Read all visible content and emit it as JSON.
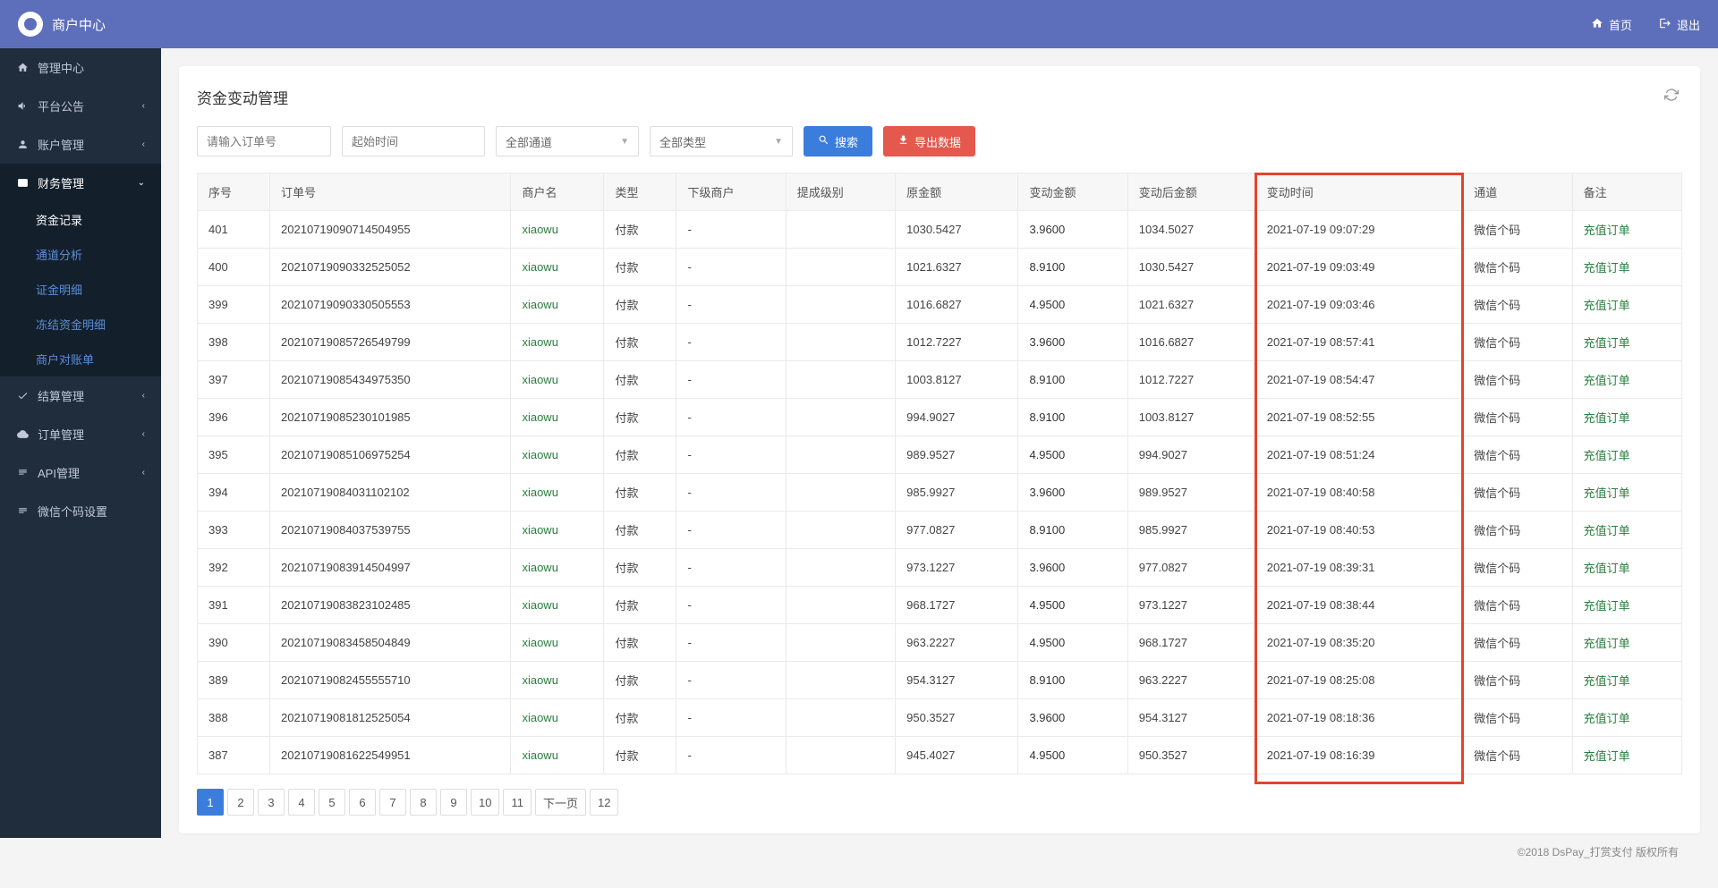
{
  "header": {
    "title": "商户中心",
    "home": "首页",
    "logout": "退出"
  },
  "sidebar": {
    "items": [
      {
        "icon": "home",
        "label": "管理中心",
        "sub": false
      },
      {
        "icon": "speaker",
        "label": "平台公告",
        "sub": true
      },
      {
        "icon": "user",
        "label": "账户管理",
        "sub": true
      },
      {
        "icon": "money",
        "label": "财务管理",
        "sub": true,
        "open": true,
        "children": [
          {
            "label": "资金记录",
            "active": true
          },
          {
            "label": "通道分析"
          },
          {
            "label": "证金明细"
          },
          {
            "label": "冻结资金明细"
          },
          {
            "label": "商户对账单"
          }
        ]
      },
      {
        "icon": "check",
        "label": "结算管理",
        "sub": true
      },
      {
        "icon": "cloud",
        "label": "订单管理",
        "sub": true
      },
      {
        "icon": "api",
        "label": "API管理",
        "sub": true
      },
      {
        "icon": "wechat",
        "label": "微信个码设置",
        "sub": false
      }
    ]
  },
  "page": {
    "title": "资金变动管理",
    "filter": {
      "order_placeholder": "请输入订单号",
      "time_placeholder": "起始时间",
      "channel_default": "全部通道",
      "type_default": "全部类型",
      "search_btn": "搜索",
      "export_btn": "导出数据"
    },
    "table": {
      "headers": [
        "序号",
        "订单号",
        "商户名",
        "类型",
        "下级商户",
        "提成级别",
        "原金额",
        "变动金额",
        "变动后金额",
        "变动时间",
        "通道",
        "备注"
      ],
      "rows": [
        {
          "seq": "401",
          "order": "20210719090714504955",
          "merchant": "xiaowu",
          "type": "付款",
          "sub": "-",
          "lvl": "",
          "orig": "1030.5427",
          "chg": "3.9600",
          "after": "1034.5027",
          "time": "2021-07-19 09:07:29",
          "channel": "微信个码",
          "remark": "充值订单"
        },
        {
          "seq": "400",
          "order": "20210719090332525052",
          "merchant": "xiaowu",
          "type": "付款",
          "sub": "-",
          "lvl": "",
          "orig": "1021.6327",
          "chg": "8.9100",
          "after": "1030.5427",
          "time": "2021-07-19 09:03:49",
          "channel": "微信个码",
          "remark": "充值订单"
        },
        {
          "seq": "399",
          "order": "20210719090330505553",
          "merchant": "xiaowu",
          "type": "付款",
          "sub": "-",
          "lvl": "",
          "orig": "1016.6827",
          "chg": "4.9500",
          "after": "1021.6327",
          "time": "2021-07-19 09:03:46",
          "channel": "微信个码",
          "remark": "充值订单"
        },
        {
          "seq": "398",
          "order": "20210719085726549799",
          "merchant": "xiaowu",
          "type": "付款",
          "sub": "-",
          "lvl": "",
          "orig": "1012.7227",
          "chg": "3.9600",
          "after": "1016.6827",
          "time": "2021-07-19 08:57:41",
          "channel": "微信个码",
          "remark": "充值订单"
        },
        {
          "seq": "397",
          "order": "20210719085434975350",
          "merchant": "xiaowu",
          "type": "付款",
          "sub": "-",
          "lvl": "",
          "orig": "1003.8127",
          "chg": "8.9100",
          "after": "1012.7227",
          "time": "2021-07-19 08:54:47",
          "channel": "微信个码",
          "remark": "充值订单"
        },
        {
          "seq": "396",
          "order": "20210719085230101985",
          "merchant": "xiaowu",
          "type": "付款",
          "sub": "-",
          "lvl": "",
          "orig": "994.9027",
          "chg": "8.9100",
          "after": "1003.8127",
          "time": "2021-07-19 08:52:55",
          "channel": "微信个码",
          "remark": "充值订单"
        },
        {
          "seq": "395",
          "order": "20210719085106975254",
          "merchant": "xiaowu",
          "type": "付款",
          "sub": "-",
          "lvl": "",
          "orig": "989.9527",
          "chg": "4.9500",
          "after": "994.9027",
          "time": "2021-07-19 08:51:24",
          "channel": "微信个码",
          "remark": "充值订单"
        },
        {
          "seq": "394",
          "order": "20210719084031102102",
          "merchant": "xiaowu",
          "type": "付款",
          "sub": "-",
          "lvl": "",
          "orig": "985.9927",
          "chg": "3.9600",
          "after": "989.9527",
          "time": "2021-07-19 08:40:58",
          "channel": "微信个码",
          "remark": "充值订单"
        },
        {
          "seq": "393",
          "order": "20210719084037539755",
          "merchant": "xiaowu",
          "type": "付款",
          "sub": "-",
          "lvl": "",
          "orig": "977.0827",
          "chg": "8.9100",
          "after": "985.9927",
          "time": "2021-07-19 08:40:53",
          "channel": "微信个码",
          "remark": "充值订单"
        },
        {
          "seq": "392",
          "order": "20210719083914504997",
          "merchant": "xiaowu",
          "type": "付款",
          "sub": "-",
          "lvl": "",
          "orig": "973.1227",
          "chg": "3.9600",
          "after": "977.0827",
          "time": "2021-07-19 08:39:31",
          "channel": "微信个码",
          "remark": "充值订单"
        },
        {
          "seq": "391",
          "order": "20210719083823102485",
          "merchant": "xiaowu",
          "type": "付款",
          "sub": "-",
          "lvl": "",
          "orig": "968.1727",
          "chg": "4.9500",
          "after": "973.1227",
          "time": "2021-07-19 08:38:44",
          "channel": "微信个码",
          "remark": "充值订单"
        },
        {
          "seq": "390",
          "order": "20210719083458504849",
          "merchant": "xiaowu",
          "type": "付款",
          "sub": "-",
          "lvl": "",
          "orig": "963.2227",
          "chg": "4.9500",
          "after": "968.1727",
          "time": "2021-07-19 08:35:20",
          "channel": "微信个码",
          "remark": "充值订单"
        },
        {
          "seq": "389",
          "order": "20210719082455555710",
          "merchant": "xiaowu",
          "type": "付款",
          "sub": "-",
          "lvl": "",
          "orig": "954.3127",
          "chg": "8.9100",
          "after": "963.2227",
          "time": "2021-07-19 08:25:08",
          "channel": "微信个码",
          "remark": "充值订单"
        },
        {
          "seq": "388",
          "order": "20210719081812525054",
          "merchant": "xiaowu",
          "type": "付款",
          "sub": "-",
          "lvl": "",
          "orig": "950.3527",
          "chg": "3.9600",
          "after": "954.3127",
          "time": "2021-07-19 08:18:36",
          "channel": "微信个码",
          "remark": "充值订单"
        },
        {
          "seq": "387",
          "order": "20210719081622549951",
          "merchant": "xiaowu",
          "type": "付款",
          "sub": "-",
          "lvl": "",
          "orig": "945.4027",
          "chg": "4.9500",
          "after": "950.3527",
          "time": "2021-07-19 08:16:39",
          "channel": "微信个码",
          "remark": "充值订单"
        }
      ]
    },
    "pagination": {
      "pages": [
        "1",
        "2",
        "3",
        "4",
        "5",
        "6",
        "7",
        "8",
        "9",
        "10",
        "11"
      ],
      "next": "下一页",
      "last": "12"
    }
  },
  "footer": "©2018 DsPay_打赏支付 版权所有"
}
